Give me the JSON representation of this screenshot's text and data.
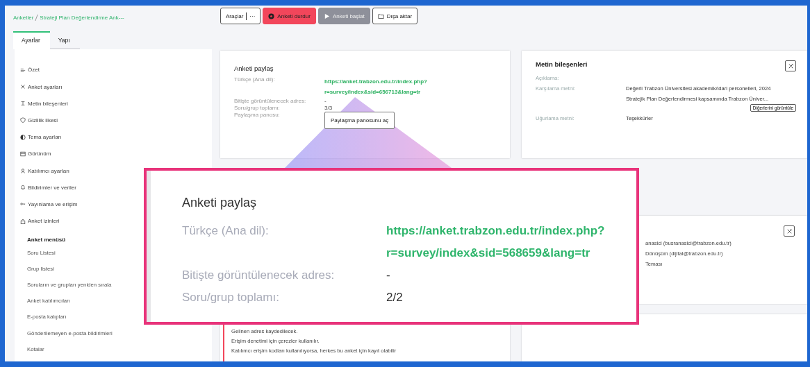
{
  "breadcrumb": [
    {
      "label": "Anketler"
    },
    {
      "label": "Strateji Plan Değerlendirme Ank---"
    }
  ],
  "tabs": [
    {
      "label": "Ayarlar",
      "selected": true
    },
    {
      "label": "Yapı",
      "selected": false
    }
  ],
  "sidebar": {
    "items": [
      {
        "label": "Özet"
      },
      {
        "label": "Anket ayarları"
      },
      {
        "label": "Metin bileşenleri"
      },
      {
        "label": "Gizlilik ilkesi"
      },
      {
        "label": "Tema ayarları"
      },
      {
        "label": "Görünüm"
      },
      {
        "label": "Katılımcı ayarları"
      },
      {
        "label": "Bildirimler ve veriler"
      },
      {
        "label": "Yayınlama ve erişim"
      },
      {
        "label": "Anket izinleri"
      }
    ],
    "submenu": {
      "title": "Anket menüsü",
      "items": [
        {
          "label": "Soru Listesi"
        },
        {
          "label": "Grup listesi"
        },
        {
          "label": "Soruların ve grupları yeniden sırala"
        },
        {
          "label": "Anket katılımcıları"
        },
        {
          "label": "E-posta kalıpları"
        },
        {
          "label": "Gönderilemeyen e-posta bildirimleri"
        },
        {
          "label": "Kotalar"
        }
      ]
    }
  },
  "toolbar": {
    "buttons": [
      {
        "kind": "tools",
        "label": "Araçlar",
        "more": "···",
        "disabled": false
      },
      {
        "kind": "stop",
        "label": "Anketi durdur",
        "disabled": false
      },
      {
        "kind": "start",
        "label": "Anketi başlat",
        "disabled": true
      },
      {
        "kind": "export",
        "label": "Dışa aktar",
        "disabled": false
      }
    ]
  },
  "share_card": {
    "title": "Anketi paylaş",
    "rows": [
      {
        "kind": "link",
        "label": "Türkçe (Ana dil):",
        "lines": [
          "https://anket.trabzon.edu.tr/index.php?",
          "r=survey/index&sid=656713&lang=tr"
        ]
      },
      {
        "kind": "text",
        "label": "Bitişte görüntülenecek adres:",
        "value": "-"
      },
      {
        "kind": "text",
        "label": "Soru/grup toplamı:",
        "value": "3/3"
      },
      {
        "kind": "button",
        "label": "Paylaşma panosu:",
        "value": "Paylaşma panosunu aç"
      }
    ]
  },
  "text_card": {
    "title": "Metin bileşenleri",
    "rows": [
      {
        "label": "Açıklama:"
      },
      {
        "label": "Karşılama metni:",
        "lines": [
          "Değerli Trabzon Üniversitesi akademik/idari personelleri, 2024",
          "Stratejik Plan Değerlendirmesi kapsamında Trabzon Üniver..."
        ],
        "button": "Diğerlerini görüntüle"
      },
      {
        "label": "Uğurlama metni:",
        "lines": [
          "Teşekkürler"
        ]
      }
    ]
  },
  "contact_card": {
    "values": [
      "anasici (busranasici@trabzon.edu.tr)",
      "Dönüşüm (dijital@trabzon.edu.tr)",
      "Teması"
    ]
  },
  "access_card": {
    "lines": [
      "Gelinen adres kaydedilecek.",
      "Erişim denetimi için çerezler kullanılır.",
      "Katılımcı erişim kodları kullanılıyorsa, herkes bu anket için kayıt olabilir"
    ]
  },
  "callout": {
    "title": "Anketi paylaş",
    "rows": [
      {
        "kind": "link",
        "label": "Türkçe (Ana dil):",
        "lines": [
          "https://anket.trabzon.edu.tr/index.php?",
          "r=survey/index&sid=568659&lang=tr"
        ]
      },
      {
        "kind": "text",
        "label": "Bitişte görüntülenecek adres:",
        "value": "-"
      },
      {
        "kind": "text",
        "label": "Soru/grup toplamı:",
        "value": "2/2"
      }
    ]
  }
}
